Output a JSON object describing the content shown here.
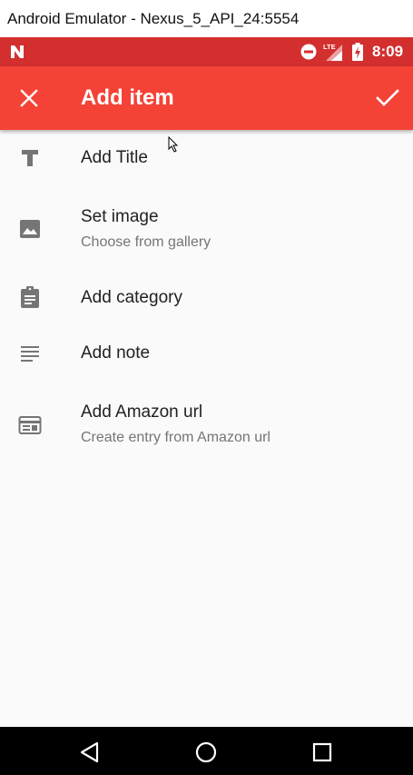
{
  "window": {
    "title": "Android Emulator - Nexus_5_API_24:5554"
  },
  "status_bar": {
    "time": "8:09",
    "icons": [
      "notification-n-icon",
      "do-not-disturb-icon",
      "lte-signal-icon",
      "battery-charging-icon"
    ],
    "lte_label": "LTE"
  },
  "app_bar": {
    "title": "Add item",
    "close_icon": "close-icon",
    "confirm_icon": "check-icon"
  },
  "items": [
    {
      "icon": "text-title-icon",
      "primary": "Add Title",
      "secondary": ""
    },
    {
      "icon": "image-icon",
      "primary": "Set image",
      "secondary": "Choose from gallery"
    },
    {
      "icon": "clipboard-icon",
      "primary": "Add category",
      "secondary": ""
    },
    {
      "icon": "notes-icon",
      "primary": "Add note",
      "secondary": ""
    },
    {
      "icon": "web-url-icon",
      "primary": "Add Amazon url",
      "secondary": "Create entry from Amazon url"
    }
  ],
  "nav_bar": {
    "buttons": [
      "back-icon",
      "home-icon",
      "recents-icon"
    ]
  },
  "colors": {
    "status_bar": "#d32f2f",
    "app_bar": "#f44336",
    "background": "#fafafa",
    "icon": "#757575"
  }
}
